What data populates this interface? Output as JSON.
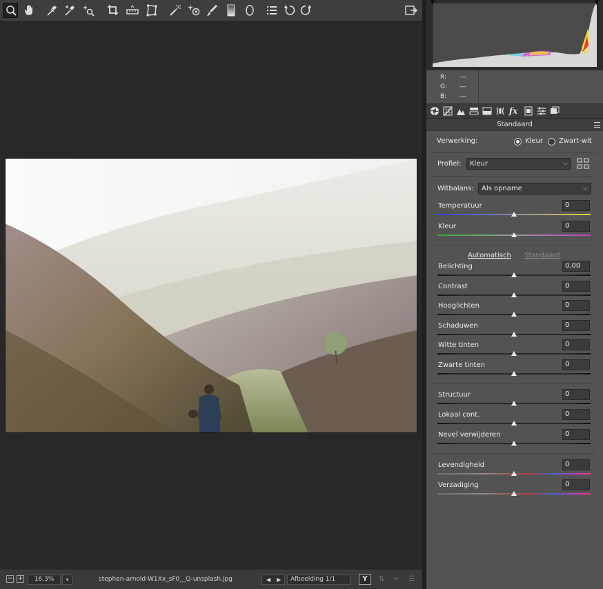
{
  "toolbar": {
    "tools": [
      {
        "name": "zoom-tool-icon",
        "active": true
      },
      {
        "name": "hand-tool-icon"
      },
      {
        "name": "white-balance-tool-icon"
      },
      {
        "name": "color-sampler-tool-icon"
      },
      {
        "name": "targeted-adjustment-tool-icon"
      },
      {
        "name": "crop-tool-icon"
      },
      {
        "name": "straighten-tool-icon"
      },
      {
        "name": "transform-tool-icon"
      },
      {
        "name": "spot-removal-tool-icon"
      },
      {
        "name": "red-eye-removal-icon"
      },
      {
        "name": "adjustment-brush-icon"
      },
      {
        "name": "graduated-filter-icon"
      },
      {
        "name": "radial-filter-icon"
      },
      {
        "name": "preferences-icon"
      },
      {
        "name": "rotate-ccw-icon"
      },
      {
        "name": "rotate-cw-icon"
      },
      {
        "name": "toggle-fullscreen-icon"
      }
    ]
  },
  "status": {
    "zoom": "16,3%",
    "filename": "stephen-arnold-W1Xx_sF0__Q-unsplash.jpg",
    "image_count": "Afbeelding 1/1",
    "y_button": "Y"
  },
  "info": {
    "r_label": "R:",
    "r_value": "---",
    "g_label": "G:",
    "g_value": "---",
    "b_label": "B:",
    "b_value": "---"
  },
  "panel": {
    "section_title": "Standaard",
    "processing_label": "Verwerking:",
    "processing_color": "Kleur",
    "processing_bw": "Zwart-wit",
    "profile_label": "Profiel:",
    "profile_value": "Kleur",
    "wb_label": "Witbalans:",
    "wb_value": "Als opname",
    "auto_label": "Automatisch",
    "default_label": "Standaard"
  },
  "sliders": [
    {
      "label": "Temperatuur",
      "value": "0",
      "track": "temperature",
      "level": 0.5
    },
    {
      "label": "Kleur",
      "value": "0",
      "track": "tint",
      "level": 0.5
    },
    {
      "label": "Belichting",
      "value": "0,00",
      "track": "neutral",
      "level": 0.5
    },
    {
      "label": "Contrast",
      "value": "0",
      "track": "neutral",
      "level": 0.5
    },
    {
      "label": "Hooglichten",
      "value": "0",
      "track": "neutral",
      "level": 0.5
    },
    {
      "label": "Schaduwen",
      "value": "0",
      "track": "neutral",
      "level": 0.5
    },
    {
      "label": "Witte tinten",
      "value": "0",
      "track": "neutral",
      "level": 0.5
    },
    {
      "label": "Zwarte tinten",
      "value": "0",
      "track": "neutral",
      "level": 0.5
    },
    {
      "label": "Structuur",
      "value": "0",
      "track": "neutral",
      "level": 0.5
    },
    {
      "label": "Lokaal cont.",
      "value": "0",
      "track": "neutral",
      "level": 0.5
    },
    {
      "label": "Nevel verwijderen",
      "value": "0",
      "track": "neutral",
      "level": 0.5
    },
    {
      "label": "Levendigheid",
      "value": "0",
      "track": "spectrum",
      "level": 0.5
    },
    {
      "label": "Verzadiging",
      "value": "0",
      "track": "spectrum",
      "level": 0.5
    }
  ],
  "colors": {
    "accent_active_tool": "#222222",
    "panel_bg": "#535353",
    "canvas_bg": "#282828"
  }
}
